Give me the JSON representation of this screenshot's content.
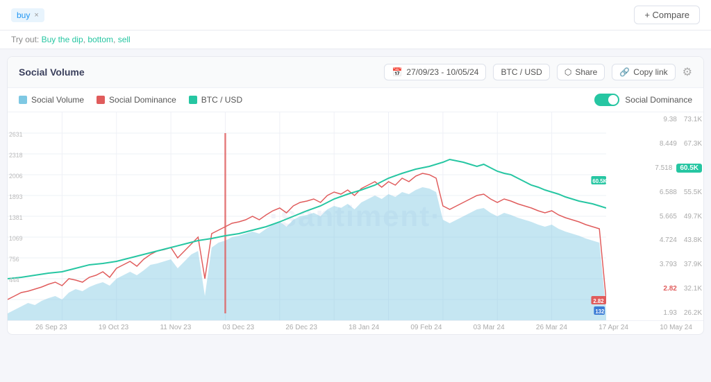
{
  "topbar": {
    "tag": "buy",
    "compare_label": "+ Compare"
  },
  "try_out": {
    "text": "Try out:",
    "links": [
      {
        "label": "Buy the dip",
        "href": "#"
      },
      {
        "label": "bottom",
        "href": "#"
      },
      {
        "label": "sell",
        "href": "#"
      }
    ]
  },
  "chart": {
    "title": "Social Volume",
    "date_range": "27/09/23 - 10/05/24",
    "pair": "BTC / USD",
    "share_label": "Share",
    "copy_label": "Copy link",
    "settings_icon": "⚙",
    "calendar_icon": "📅",
    "share_icon": "⬡",
    "copy_icon": "🔗",
    "legend": [
      {
        "label": "Social Volume",
        "color": "cyan"
      },
      {
        "label": "Social Dominance",
        "color": "red"
      },
      {
        "label": "BTC / USD",
        "color": "green"
      }
    ],
    "toggle_label": "Social Dominance",
    "watermark": "·santiment·",
    "y_axis_left": [
      "2631",
      "2318",
      "2006",
      "1893",
      "1381",
      "1069",
      "756",
      "444"
    ],
    "y_axis_mid": [
      "9.38",
      "8.449",
      "7.518",
      "6.588",
      "5.665",
      "4.724",
      "3.793",
      "2.82",
      "1.93"
    ],
    "y_axis_right": [
      "73.1K",
      "67.3K",
      "60.5K",
      "55.5K",
      "49.7K",
      "43.8K",
      "37.9K",
      "32.1K",
      "26.2K"
    ],
    "x_axis": [
      "26 Sep 23",
      "19 Oct 23",
      "11 Nov 23",
      "03 Dec 23",
      "26 Dec 23",
      "18 Jan 24",
      "09 Feb 24",
      "03 Mar 24",
      "26 Mar 24",
      "17 Apr 24",
      "10 May 24"
    ],
    "badges": {
      "green_value": "60.5K",
      "red_value": "2.82",
      "blue_value": "132"
    }
  }
}
